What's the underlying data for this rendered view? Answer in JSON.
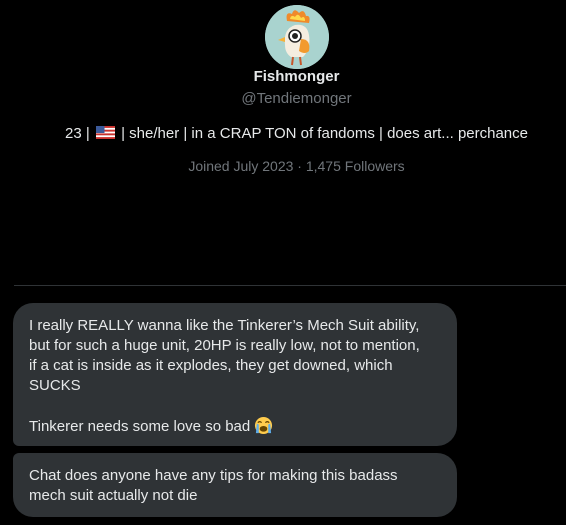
{
  "profile": {
    "display_name": "Fishmonger",
    "handle": "@Tendiemonger",
    "bio_before_flag": "23 |",
    "bio_flag_icon": "us-flag-icon",
    "bio_after_flag": "| she/her | in a CRAP TON of fandoms | does art... perchance",
    "joined": "Joined July 2023 · 1,475 Followers",
    "avatar_icon": "rooster-avatar-icon"
  },
  "messages": [
    {
      "paragraphs": [
        "I really REALLY wanna like the Tinkerer’s Mech Suit ability,\nbut for such a huge unit, 20HP is really low, not to mention,\nif a cat is inside as it explodes, they get downed, which\nSUCKS",
        "Tinkerer needs some love so bad"
      ],
      "emoji_icon": "loudly-crying-face-icon"
    },
    {
      "paragraphs": [
        "Chat does anyone have any tips for making this badass\nmech suit actually not die"
      ]
    }
  ],
  "colors": {
    "background": "#000000",
    "bubble": "#2f3336",
    "text_primary": "#e7e9ea",
    "text_secondary": "#71767b",
    "divider": "#2f3336"
  }
}
